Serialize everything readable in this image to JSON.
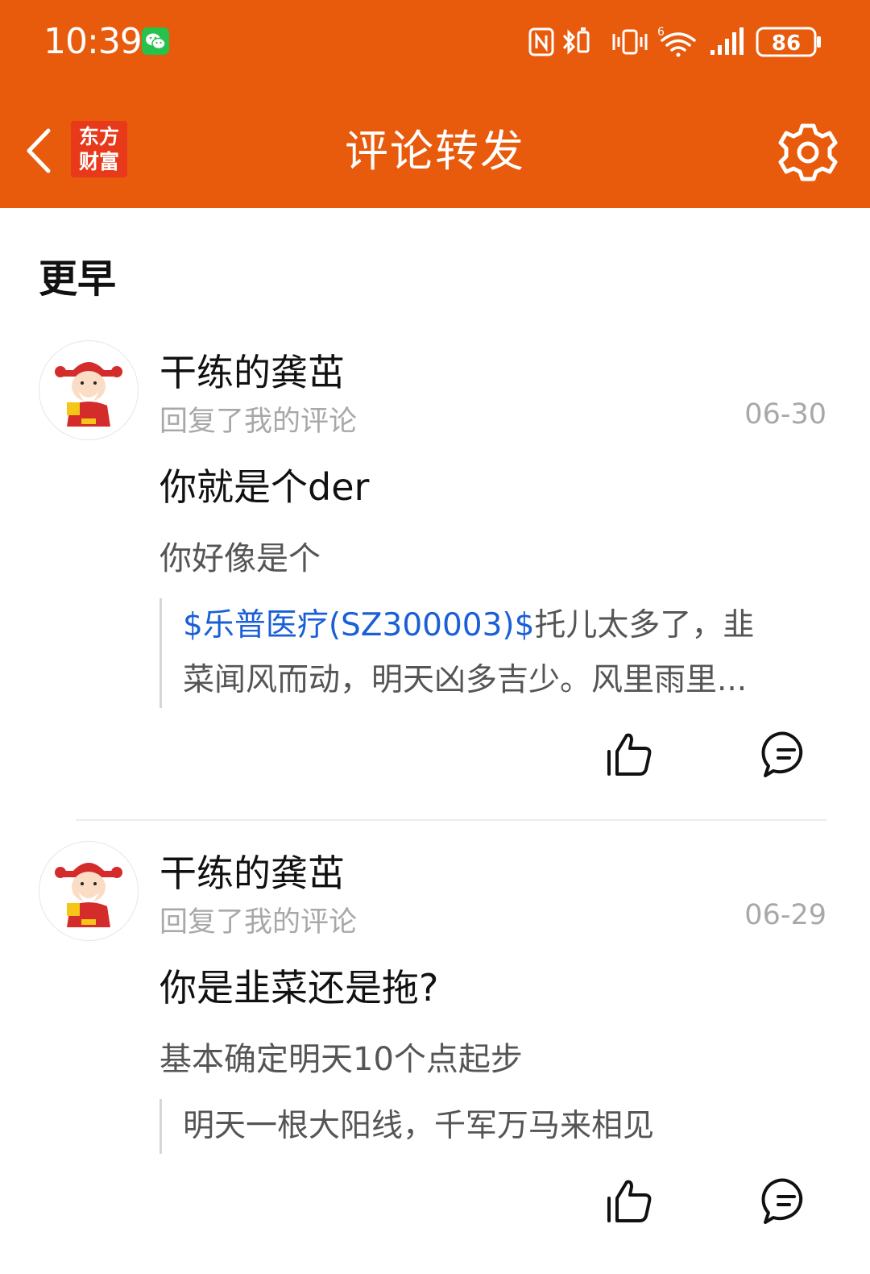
{
  "status_bar": {
    "time": "10:39",
    "battery": "86"
  },
  "nav": {
    "logo_line1": "东方",
    "logo_line2": "财富",
    "title": "评论转发"
  },
  "section_title": "更早",
  "items": [
    {
      "user": "干练的龚茁",
      "action": "回复了我的评论",
      "date": "06-30",
      "reply": "你就是个der",
      "original": "你好像是个",
      "quote_link": "$乐普医疗(SZ300003)$",
      "quote_line1_rest": "托儿太多了，韭",
      "quote_line2": "菜闻风而动，明天凶多吉少。风里雨里..."
    },
    {
      "user": "干练的龚茁",
      "action": "回复了我的评论",
      "date": "06-29",
      "reply": "你是韭菜还是拖?",
      "original": "基本确定明天10个点起步",
      "quote_line1": "明天一根大阳线，千军万马来相见"
    }
  ],
  "colors": {
    "header": "#e85a0c",
    "link": "#1a5fd6",
    "muted": "#a8a8a8"
  },
  "icons": [
    "wechat-icon",
    "nfc-icon",
    "bluetooth-icon",
    "vibrate-icon",
    "wifi-icon",
    "signal-icon",
    "battery-icon",
    "back-chevron-icon",
    "gear-icon",
    "thumbs-up-icon",
    "comment-icon"
  ]
}
